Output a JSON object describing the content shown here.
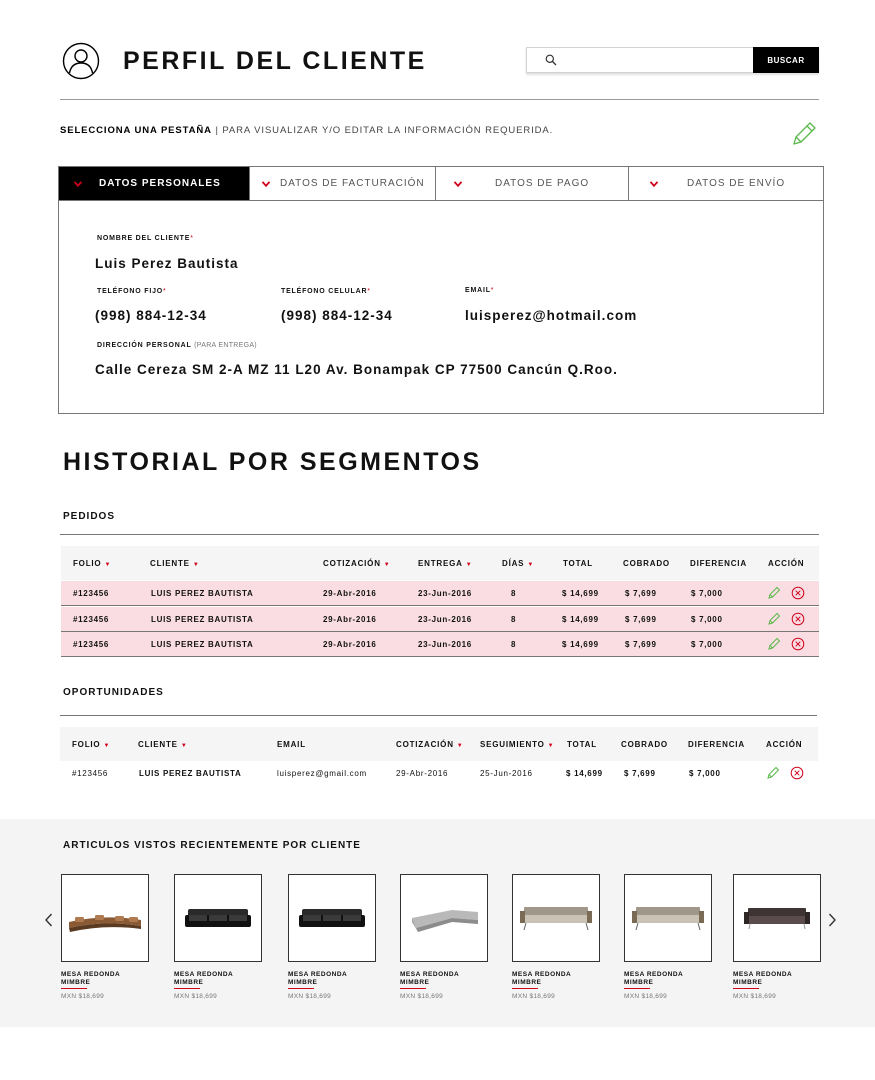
{
  "header": {
    "title": "PERFIL DEL CLIENTE",
    "search_placeholder": "",
    "search_button": "BUSCAR"
  },
  "instruction": {
    "bold": "SELECCIONA UNA PESTAÑA",
    "separator": " | ",
    "text": "PARA VISUALIZAR Y/O EDITAR LA INFORMACIÓN REQUERIDA."
  },
  "tabs": [
    {
      "label": "DATOS PERSONALES",
      "active": true
    },
    {
      "label": "DATOS DE FACTURACIÓN",
      "active": false
    },
    {
      "label": "DATOS DE PAGO",
      "active": false
    },
    {
      "label": "DATOS DE ENVÍO",
      "active": false
    }
  ],
  "personal": {
    "name_label": "NOMBRE DEL CLIENTE",
    "name": "Luis Perez Bautista",
    "phone_label": "TELÉFONO FIJO",
    "phone": "(998) 884-12-34",
    "mobile_label": "TELÉFONO CELULAR",
    "mobile": "(998) 884-12-34",
    "email_label": "EMAIL",
    "email": "luisperez@hotmail.com",
    "address_label": "DIRECCIÓN PERSONAL",
    "address_note": "(PARA ENTREGA)",
    "address": "Calle Cereza SM 2-A MZ 11 L20 Av. Bonampak CP 77500 Cancún Q.Roo.",
    "required_mark": "*"
  },
  "history": {
    "title": "HISTORIAL POR SEGMENTOS",
    "orders": {
      "title": "PEDIDOS",
      "columns": [
        "FOLIO",
        "CLIENTE",
        "COTIZACIÓN",
        "ENTREGA",
        "DÍAS",
        "TOTAL",
        "COBRADO",
        "DIFERENCIA",
        "ACCIÓN"
      ],
      "rows": [
        {
          "folio": "#123456",
          "cliente": "LUIS PEREZ BAUTISTA",
          "cotizacion": "29-Abr-2016",
          "entrega": "23-Jun-2016",
          "dias": "8",
          "total": "$ 14,699",
          "cobrado": "$ 7,699",
          "diferencia": "$ 7,000"
        },
        {
          "folio": "#123456",
          "cliente": "LUIS PEREZ BAUTISTA",
          "cotizacion": "29-Abr-2016",
          "entrega": "23-Jun-2016",
          "dias": "8",
          "total": "$ 14,699",
          "cobrado": "$ 7,699",
          "diferencia": "$ 7,000"
        },
        {
          "folio": "#123456",
          "cliente": "LUIS PEREZ BAUTISTA",
          "cotizacion": "29-Abr-2016",
          "entrega": "23-Jun-2016",
          "dias": "8",
          "total": "$ 14,699",
          "cobrado": "$ 7,699",
          "diferencia": "$ 7,000"
        }
      ]
    },
    "opportunities": {
      "title": "OPORTUNIDADES",
      "columns": [
        "FOLIO",
        "CLIENTE",
        "EMAIL",
        "COTIZACIÓN",
        "SEGUIMIENTO",
        "TOTAL",
        "COBRADO",
        "DIFERENCIA",
        "ACCIÓN"
      ],
      "rows": [
        {
          "folio": "#123456",
          "cliente": "LUIS PEREZ BAUTISTA",
          "email": "luisperez@gmail.com",
          "cotizacion": "29-Abr-2016",
          "seguimiento": "25-Jun-2016",
          "total": "$ 14,699",
          "cobrado": "$ 7,699",
          "diferencia": "$ 7,000"
        }
      ]
    }
  },
  "recent": {
    "title": "ARTICULOS VISTOS RECIENTEMENTE POR CLIENTE",
    "items": [
      {
        "name": "MESA REDONDA MIMBRE",
        "price": "MXN $18,699",
        "image": "curved-sofa-brown"
      },
      {
        "name": "MESA REDONDA MIMBRE",
        "price": "MXN $18,699",
        "image": "sofa-black-leather"
      },
      {
        "name": "MESA REDONDA MIMBRE",
        "price": "MXN $18,699",
        "image": "sofa-black-leather"
      },
      {
        "name": "MESA REDONDA MIMBRE",
        "price": "MXN $18,699",
        "image": "sectional-sofa-light-grey"
      },
      {
        "name": "MESA REDONDA MIMBRE",
        "price": "MXN $18,699",
        "image": "sofa-beige"
      },
      {
        "name": "MESA REDONDA MIMBRE",
        "price": "MXN $18,699",
        "image": "sofa-beige"
      },
      {
        "name": "MESA REDONDA MIMBRE",
        "price": "MXN $18,699",
        "image": "sofa-dark-brown"
      }
    ]
  },
  "colors": {
    "accent": "#d0021b",
    "pink_row": "#f9dde2",
    "edit_icon": "#59b84a",
    "black": "#000000",
    "light_bg": "#f4f4f4"
  }
}
